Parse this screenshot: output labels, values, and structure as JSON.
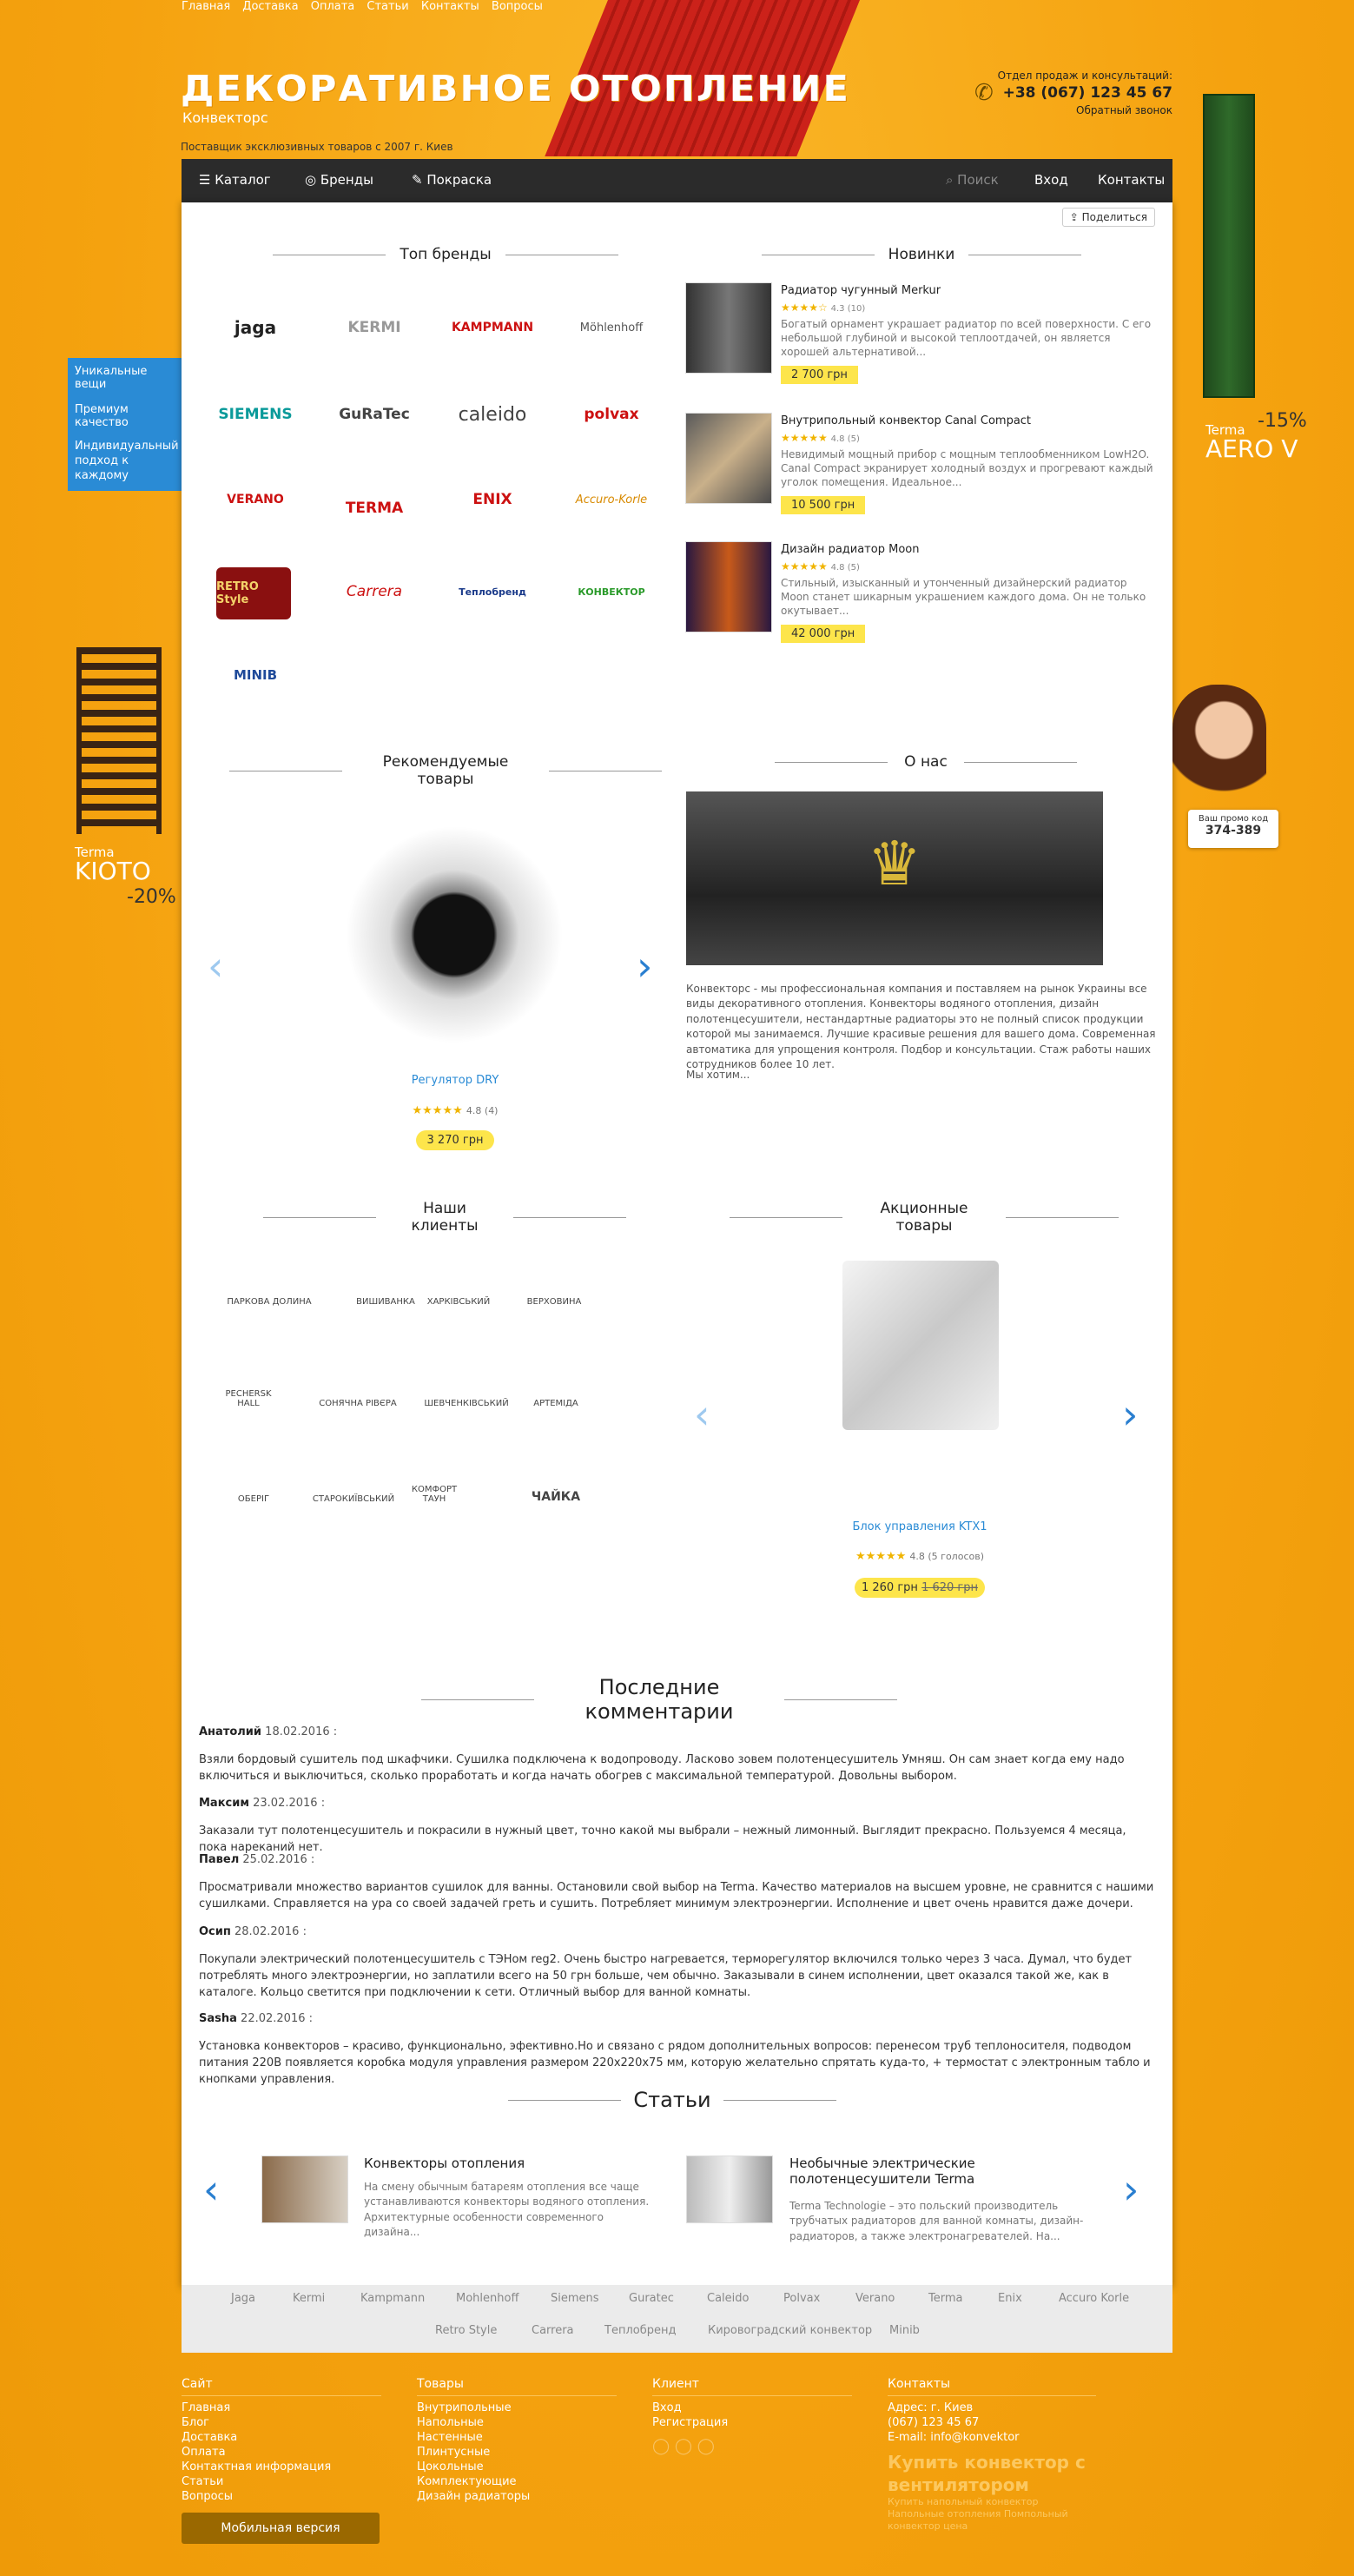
{
  "top_nav": [
    "Главная",
    "Доставка",
    "Оплата",
    "Статьи",
    "Контакты",
    "Вопросы"
  ],
  "logo": {
    "title": "ДЕКОРАТИВНОЕ ОТОПЛЕНИЕ",
    "subtitle": "Конвекторс"
  },
  "tagline": "Поставщик эксклюзивных товаров с 2007 г. Киев",
  "contact": {
    "label": "Отдел продаж и консультаций:",
    "phone": "+38 (067) 123 45 67",
    "callback": "Обратный звонок"
  },
  "navbar": {
    "catalog": "Каталог",
    "brands": "Бренды",
    "paint": "Покраска",
    "search_placeholder": "Поиск",
    "login": "Вход",
    "contacts": "Контакты"
  },
  "share": "Поделиться",
  "left_buttons": [
    "Уникальные вещи",
    "Премиум качество",
    "Индивидуальный подход к каждому"
  ],
  "side_promo_right": {
    "name": "Terma",
    "model": "AERO V",
    "discount": "-15%"
  },
  "side_promo_left": {
    "name": "Terma",
    "model": "KIOTO",
    "discount": "-20%"
  },
  "promo_code": {
    "label": "Ваш промо код",
    "code": "374-389"
  },
  "sections": {
    "top_brands": "Топ бренды",
    "new": "Новинки",
    "recommended": "Рекомендуемые товары",
    "about": "О нас",
    "clients": "Наши клиенты",
    "sale": "Акционные товары",
    "comments": "Последние комментарии",
    "articles": "Статьи"
  },
  "brands": [
    "jaga",
    "KERMI",
    "KAMPMANN",
    "Möhlenhoff",
    "SIEMENS",
    "GuRaTec",
    "caleido",
    "polvax",
    "VERANO",
    "TERMA",
    "ENIX",
    "Accuro-Korle",
    "RETRO Style",
    "Carrera",
    "Теплобренд",
    "КОНВЕКТОР",
    "MINIB"
  ],
  "new_products": [
    {
      "title": "Радиатор чугунный Merkur",
      "rating": "4.3 (10)",
      "desc": "Богатый орнамент украшает радиатор по всей поверхности. С его небольшой глубиной и высокой теплоотдачей, он является хорошей альтернативой...",
      "price": "2 700 грн"
    },
    {
      "title": "Внутрипольный конвектор Canal Compact",
      "rating": "4.8 (5)",
      "desc": "Невидимый мощный прибор с мощным теплообменником LowH2O. Canal Compact экранирует холодный воздух и прогревают каждый уголок помещения. Идеальное...",
      "price": "10 500 грн"
    },
    {
      "title": "Дизайн радиатор Moon",
      "rating": "4.8 (5)",
      "desc": "Стильный, изысканный и утонченный  дизайнерский радиатор Moon  станет шикарным украшением каждого дома. Он не только окутывает...",
      "price": "42 000 грн"
    }
  ],
  "recommended": {
    "name": "Регулятор DRY",
    "rating": "4.8 (4)",
    "price": "3 270 грн"
  },
  "about": {
    "text": "Конвекторс - мы профессиональная компания и поставляем на рынок Украины все виды декоративного отопления. Конвекторы водяного отопления, дизайн полотенцесушители, нестандартные радиаторы это не полный список продукции которой мы занимаемся. Лучшие красивые решения для вашего дома. Современная автоматика для упрощения контроля. Подбор и консультации. Стаж работы наших сотрудников более 10 лет.",
    "more": "Мы хотим..."
  },
  "clients": [
    "ПАРКОВА ДОЛИНА",
    "ВИШИВАНКА",
    "ХАРКІВСЬКИЙ",
    "ВЕРХОВИНА",
    "PECHERSK HALL",
    "СОНЯЧНА РІВЄРА",
    "ШЕВЧЕНКІВСЬКИЙ",
    "АРТЕМІДА",
    "ОБЕРІГ",
    "СТАРОКИЇВСЬКИЙ",
    "КОМФОРТ ТАУН",
    "ЧАЙКА"
  ],
  "sale": {
    "name": "Блок управления KTX1",
    "rating": "4.8 (5 голосов)",
    "price": "1 260 грн",
    "old_price": "1 620 грн"
  },
  "comments": [
    {
      "author": "Анатолий",
      "date": "18.02.2016 :",
      "text": "Взяли бордовый сушитель под шкафчики. Сушилка подключена к водопроводу. Ласково зовем полотенцесушитель Умняш. Он сам знает когда ему надо включиться и выключиться, сколько проработать и когда начать обогрев с максимальной температурой. Довольны выбором."
    },
    {
      "author": "Максим",
      "date": "23.02.2016 :",
      "text": "Заказали тут полотенцесушитель и покрасили в нужный цвет, точно какой мы выбрали – нежный лимонный. Выглядит прекрасно. Пользуемся 4 месяца, пока нареканий нет."
    },
    {
      "author": "Павел",
      "date": "25.02.2016 :",
      "text": "Просматривали множество вариантов сушилок для ванны. Остановили свой выбор на Terma. Качество материалов на высшем уровне, не сравнится с нашими сушилками. Справляется на ура со своей задачей греть и сушить. Потребляет минимум электроэнергии. Исполнение и цвет очень нравится даже дочери."
    },
    {
      "author": "Осип",
      "date": "28.02.2016 :",
      "text": "Покупали электрический полотенцесушитель с ТЭНом reg2. Очень быстро нагревается, терморегулятор включился только через 3 часа. Думал, что будет потреблять много электроэнергии, но заплатили всего на 50 грн больше, чем обычно. Заказывали в синем исполнении, цвет оказался такой же, как в каталоге. Кольцо светится при подключении к сети. Отличный выбор для ванной комнаты."
    },
    {
      "author": "Sasha",
      "date": "22.02.2016 :",
      "text": "Установка конвекторов – красиво, функционально, эфективно.Но и связано с рядом дополнительных вопросов: перенесом труб теплоносителя, подводом питания 220В появляется коробка модуля управления размером 220х220х75 мм, которую желательно спрятать куда-то, + термостат с электронным табло и кнопками управления."
    }
  ],
  "articles": [
    {
      "title": "Конвекторы отопления",
      "text": "На смену обычным батареям отопления все чаще устанавливаются конвекторы водяного отопления. Архитектурные особенности современного дизайна..."
    },
    {
      "title": "Необычные электрические полотенцесушители Terma",
      "text": "Terma Technologie – это польский производитель трубчатых радиаторов для ванной комнаты, дизайн-радиаторов, а также электронагревателей. На..."
    }
  ],
  "brand_bar_row1": [
    "Jaga",
    "Kermi",
    "Kampmann",
    "Mohlenhoff",
    "Siemens",
    "Guratec",
    "Caleido",
    "Polvax",
    "Verano",
    "Terma",
    "Enix",
    "Accuro Korle"
  ],
  "brand_bar_row2": [
    "Retro Style",
    "Carrera",
    "Теплобренд",
    "Кировоградский конвектор",
    "Minib"
  ],
  "footer": {
    "site": {
      "title": "Сайт",
      "items": [
        "Главная",
        "Блог",
        "Доставка",
        "Оплата",
        "Контактная информация",
        "Статьи",
        "Вопросы"
      ]
    },
    "goods": {
      "title": "Товары",
      "items": [
        "Внутрипольные",
        "Напольные",
        "Настенные",
        "Плинтусные",
        "Цокольные",
        "Комплектующие",
        "Дизайн радиаторы"
      ]
    },
    "client": {
      "title": "Клиент",
      "items": [
        "Вход",
        "Регистрация"
      ]
    },
    "contacts": {
      "title": "Контакты",
      "items": [
        "Адрес: г. Киев",
        "(067) 123 45 67",
        "E-mail: info@konvektor"
      ]
    },
    "seo_big": "Купить конвектор с вентилятором",
    "seo_small": "Купить напольный конвектор Напольные отопления Помпольный конвектор цена"
  },
  "mobile_version": "Мобильная версия"
}
